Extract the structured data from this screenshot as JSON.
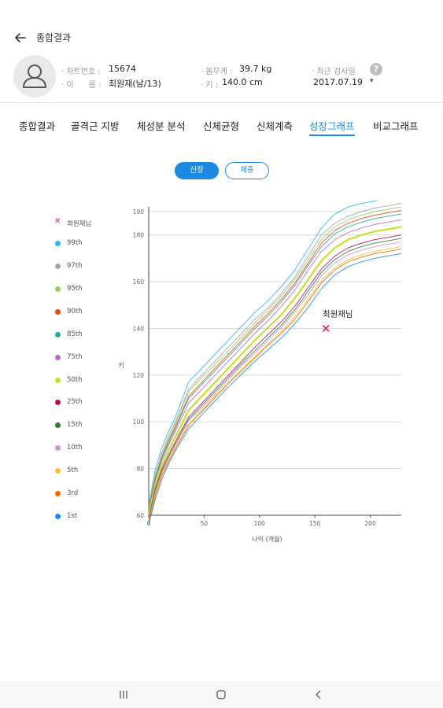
{
  "header": {
    "title": "종합결과"
  },
  "profile": {
    "chart_no_label": "· 차트번호 :",
    "chart_no_value": "15674",
    "name_label": "· 이      름 :",
    "name_value": "최원재(남/13)",
    "weight_label": "· 몸무게 :",
    "weight_value": "39.7 kg",
    "height_label": "· 키 :",
    "height_value": "140.0 cm",
    "recent_label": "· 최근 검사일",
    "recent_value": "2017.07.19",
    "recent_dropdown": "▾",
    "help": "?"
  },
  "tabs": [
    {
      "label": "종합결과"
    },
    {
      "label": "골격근 지방"
    },
    {
      "label": "체성분 분석"
    },
    {
      "label": "신체균형"
    },
    {
      "label": "신체계측"
    },
    {
      "label": "성장그래프"
    },
    {
      "label": "비교그래프"
    }
  ],
  "active_tab": 5,
  "toggles": {
    "height": "신장",
    "weight": "체중",
    "selected": "height"
  },
  "legend": [
    {
      "label": "최원재님",
      "color": "#d81b60",
      "marker": "x"
    },
    {
      "label": "99th",
      "color": "#29b6f6"
    },
    {
      "label": "97th",
      "color": "#a5a5a5"
    },
    {
      "label": "95th",
      "color": "#9ccc65"
    },
    {
      "label": "90th",
      "color": "#e64a19"
    },
    {
      "label": "85th",
      "color": "#26a69a"
    },
    {
      "label": "75th",
      "color": "#ba68c8"
    },
    {
      "label": "50th",
      "color": "#c6e22a"
    },
    {
      "label": "25th",
      "color": "#ad1457"
    },
    {
      "label": "15th",
      "color": "#2e7d32"
    },
    {
      "label": "10th",
      "color": "#ce93d8"
    },
    {
      "label": "5th",
      "color": "#fbc02d"
    },
    {
      "label": "3rd",
      "color": "#ef6c00"
    },
    {
      "label": "1st",
      "color": "#1e88e5"
    }
  ],
  "chart_data": {
    "type": "line",
    "xlabel": "나이 (개월)",
    "ylabel": "키",
    "xlim": [
      0,
      228
    ],
    "ylim": [
      60,
      190
    ],
    "xticks": [
      0,
      50,
      100,
      150,
      200
    ],
    "yticks": [
      60,
      80,
      100,
      120,
      140,
      160,
      180,
      190
    ],
    "grid": "horizontal",
    "x": [
      0,
      6,
      12,
      18,
      24,
      36,
      48,
      60,
      72,
      84,
      96,
      108,
      120,
      132,
      144,
      156,
      168,
      180,
      192,
      204,
      216,
      228
    ],
    "series": [
      {
        "name": "99th",
        "color": "#29b6f6",
        "values": [
          64,
          80,
          89,
          96,
          102,
          117,
          123,
          129,
          135,
          141,
          147,
          152,
          158,
          165,
          174,
          183,
          189,
          192,
          193.5,
          194.5,
          195.5,
          196.5
        ]
      },
      {
        "name": "97th",
        "color": "#a5a5a5",
        "values": [
          63,
          78,
          87,
          94,
          100,
          114,
          120,
          126,
          132,
          138,
          144,
          149,
          155,
          162,
          171,
          180,
          185,
          188,
          190,
          191.5,
          192.5,
          193.5
        ]
      },
      {
        "name": "95th",
        "color": "#9ccc65",
        "values": [
          62.5,
          77,
          86,
          93,
          99,
          113,
          119,
          124.5,
          130.5,
          136.5,
          142.5,
          148,
          154,
          161,
          169.5,
          178,
          183.5,
          186.5,
          188.5,
          190,
          191,
          192
        ]
      },
      {
        "name": "90th",
        "color": "#e64a19",
        "values": [
          62,
          76,
          85,
          92,
          98,
          111,
          117,
          123,
          129,
          135,
          141,
          146.5,
          152.5,
          159.5,
          168,
          176.5,
          182,
          185,
          187,
          188.5,
          189.5,
          190.5
        ]
      },
      {
        "name": "85th",
        "color": "#26a69a",
        "values": [
          61.5,
          75.5,
          84.5,
          91,
          97,
          110,
          116,
          122,
          128,
          134,
          140,
          145.5,
          151.5,
          158.5,
          167,
          175,
          180.5,
          183.5,
          185.5,
          187,
          188,
          189
        ]
      },
      {
        "name": "75th",
        "color": "#ba68c8",
        "values": [
          61,
          75,
          83.5,
          90,
          96,
          108,
          114,
          120,
          126,
          132,
          138,
          143.5,
          149.5,
          156.5,
          165,
          173,
          178,
          181,
          183,
          184.5,
          185.5,
          186.5
        ]
      },
      {
        "name": "50th",
        "color": "#c6e22a",
        "values": [
          60,
          73,
          81.5,
          88,
          93.5,
          105,
          111,
          117,
          123,
          129,
          135,
          140.5,
          146,
          153,
          161,
          169,
          174.5,
          178,
          180,
          181.5,
          182.5,
          183.5
        ]
      },
      {
        "name": "25th",
        "color": "#ad1457",
        "values": [
          59,
          71.5,
          80,
          86,
          91.5,
          102,
          108,
          114,
          120,
          126,
          132,
          137.5,
          143,
          149.5,
          157.5,
          165.5,
          171,
          174.5,
          176.5,
          178,
          179,
          180
        ]
      },
      {
        "name": "15th",
        "color": "#2e7d32",
        "values": [
          58.5,
          71,
          79,
          85,
          90.5,
          101,
          107,
          113,
          119,
          125,
          130.5,
          136,
          141.5,
          148,
          156,
          164,
          169.5,
          173,
          175,
          176.5,
          177.5,
          178.5
        ]
      },
      {
        "name": "10th",
        "color": "#ce93d8",
        "values": [
          58,
          70,
          78.5,
          84.5,
          90,
          100.5,
          106,
          112,
          118,
          124,
          129.5,
          135,
          140.5,
          147,
          154.5,
          162.5,
          168,
          171.5,
          173.5,
          175,
          176,
          177
        ]
      },
      {
        "name": "5th",
        "color": "#fbc02d",
        "values": [
          57.5,
          69,
          77.5,
          83.5,
          89,
          99,
          105,
          111,
          117,
          122.5,
          128,
          133.5,
          139,
          145,
          152.5,
          160.5,
          166,
          169.5,
          171.5,
          173,
          174,
          175
        ]
      },
      {
        "name": "3rd",
        "color": "#ef6c00",
        "values": [
          57,
          68.5,
          77,
          83,
          88.5,
          98.5,
          104.5,
          110.5,
          116.5,
          122,
          127.5,
          133,
          138,
          144,
          151.5,
          159.5,
          165,
          168.5,
          170.5,
          172,
          173,
          174
        ]
      },
      {
        "name": "1st",
        "color": "#1e88e5",
        "values": [
          56,
          67,
          75.5,
          82,
          87.5,
          97,
          103,
          109,
          115,
          120.5,
          126,
          131,
          136,
          142,
          149,
          157,
          163,
          166.5,
          168.5,
          170,
          171,
          172
        ]
      }
    ],
    "highlight_series": "50th",
    "patient": {
      "name": "최원재님",
      "x": 160,
      "y": 140,
      "color": "#d81b60"
    }
  }
}
